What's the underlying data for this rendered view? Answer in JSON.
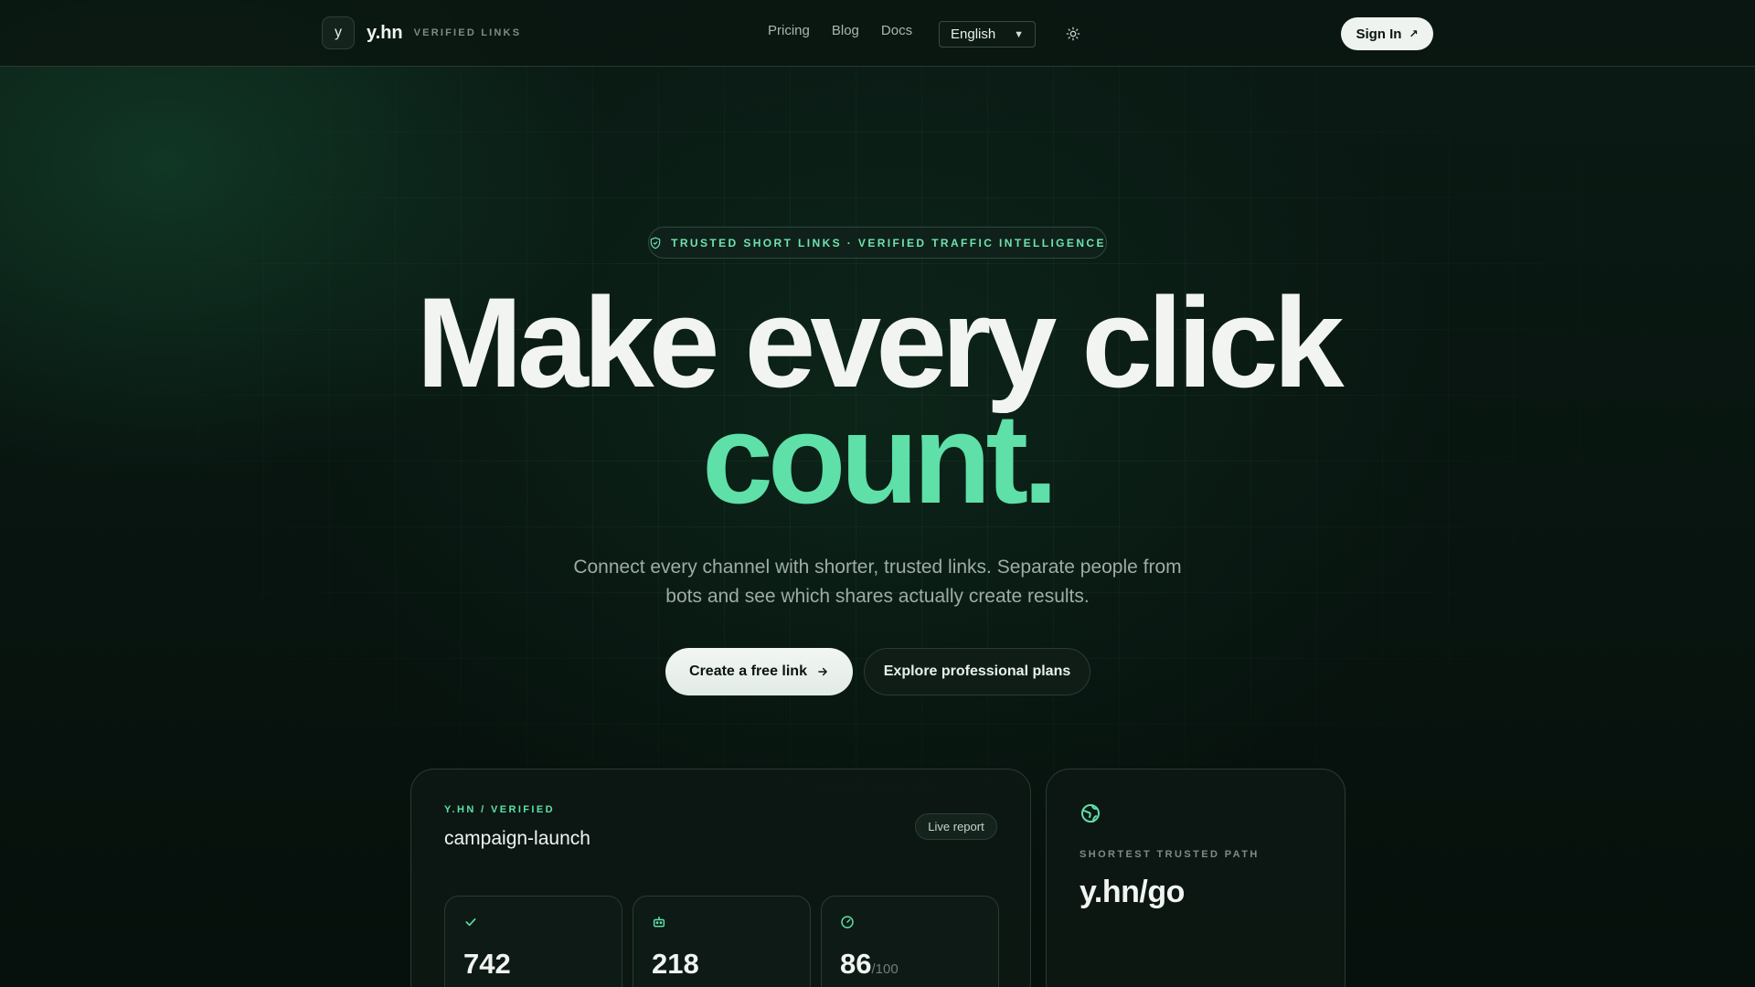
{
  "brand": {
    "mark": "y",
    "name": "y.hn",
    "tagline": "VERIFIED LINKS"
  },
  "nav": {
    "items": [
      "Pricing",
      "Blog",
      "Docs"
    ]
  },
  "language": {
    "selected": "English"
  },
  "header": {
    "sign_in": "Sign In"
  },
  "hero": {
    "badge": "TRUSTED SHORT LINKS · VERIFIED TRAFFIC INTELLIGENCE",
    "headline_line1": "Make every click",
    "headline_line2": "count.",
    "subtitle": "Connect every channel with shorter, trusted links. Separate people from bots and see which shares actually create results.",
    "cta_primary": "Create a free link",
    "cta_secondary": "Explore professional plans"
  },
  "report_card": {
    "eyebrow": "Y.HN / VERIFIED",
    "title": "campaign-launch",
    "live_label": "Live report",
    "stats": [
      {
        "icon": "check-icon",
        "value": "742"
      },
      {
        "icon": "bot-icon",
        "value": "218"
      },
      {
        "icon": "gauge-icon",
        "value": "86",
        "unit": "/100"
      }
    ]
  },
  "path_card": {
    "icon": "globe-icon",
    "label": "SHORTEST TRUSTED PATH",
    "path": "y.hn/go"
  },
  "colors": {
    "accent": "#5ee0a8",
    "background": "#07110d",
    "surface": "#0e1a15"
  }
}
